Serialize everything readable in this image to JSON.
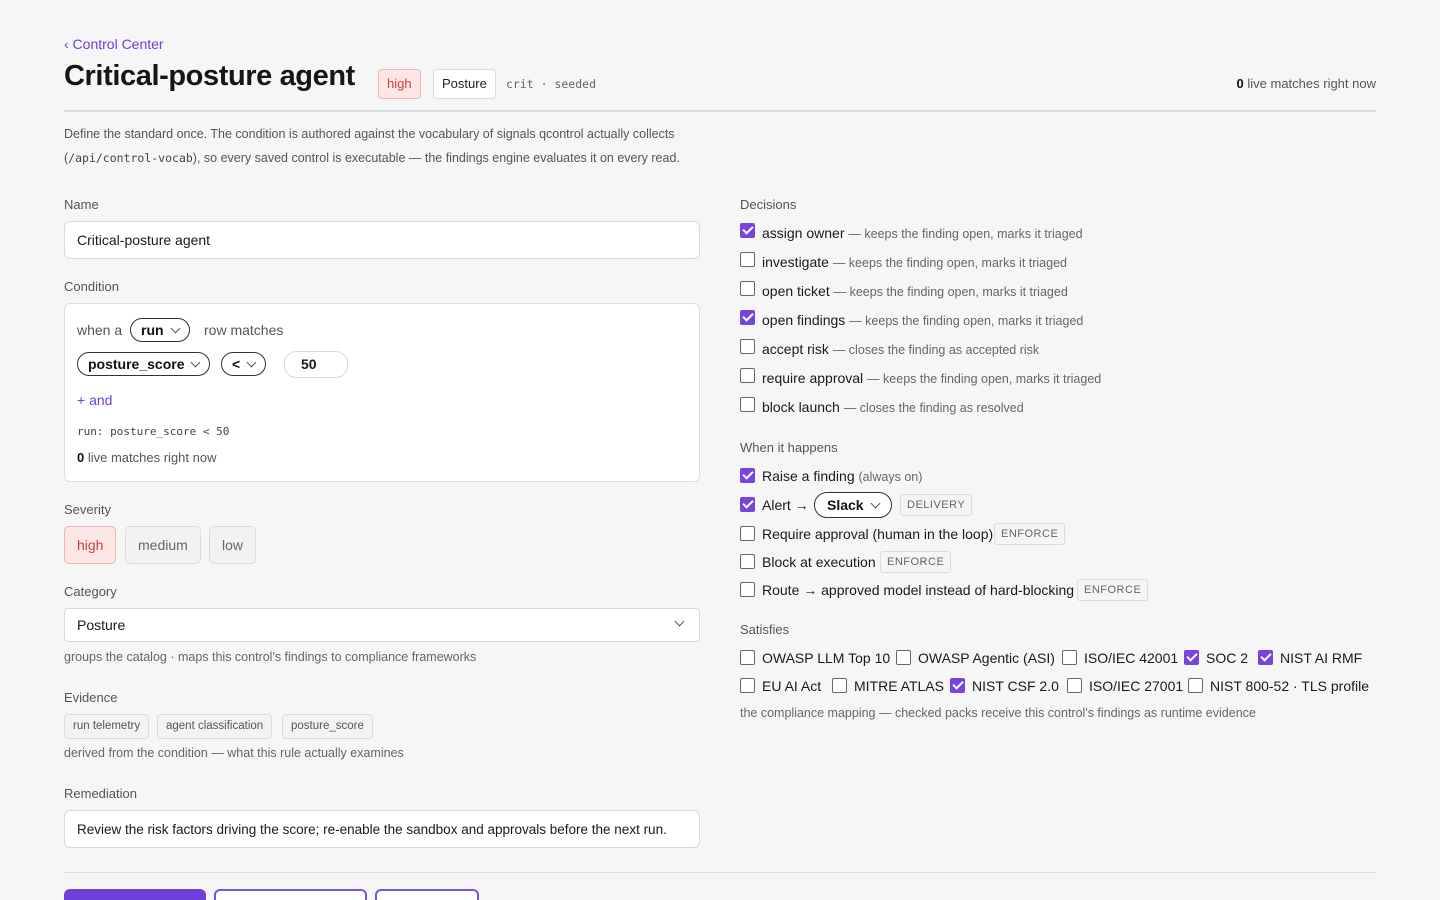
{
  "back_link": "‹ Control Center",
  "header": {
    "title": "Critical-posture agent",
    "severity_badge": "high",
    "category_badge": "Posture",
    "meta": "crit · seeded",
    "live_count": "0",
    "live_suffix": "live matches right now"
  },
  "intro": {
    "text_a": "Define the standard once. The condition is authored against the vocabulary of signals qcontrol actually collects (",
    "code": "/api/control-vocab",
    "text_b": "), so every saved control is executable — the findings engine evaluates it on every read."
  },
  "name": {
    "label": "Name",
    "value": "Critical-posture agent"
  },
  "condition": {
    "label": "Condition",
    "when_prefix": "when a",
    "entity": "run",
    "when_suffix": "row matches",
    "field": "posture_score",
    "operator": "<",
    "value": "50",
    "add_and": "+ and",
    "expression": "run: posture_score < 50",
    "live_count": "0",
    "live_suffix": "live matches right now"
  },
  "severity": {
    "label": "Severity",
    "options": [
      "high",
      "medium",
      "low"
    ],
    "selected": "high"
  },
  "category": {
    "label": "Category",
    "value": "Posture",
    "help": "groups the catalog · maps this control's findings to compliance frameworks"
  },
  "evidence": {
    "label": "Evidence",
    "tags": [
      "run telemetry",
      "agent classification",
      "posture_score"
    ],
    "help": "derived from the condition — what this rule actually examines"
  },
  "remediation": {
    "label": "Remediation",
    "value": "Review the risk factors driving the score; re-enable the sandbox and approvals before the next run."
  },
  "decisions": {
    "label": "Decisions",
    "items": [
      {
        "name": "assign owner",
        "desc": "— keeps the finding open, marks it triaged",
        "checked": true
      },
      {
        "name": "investigate",
        "desc": "— keeps the finding open, marks it triaged",
        "checked": false
      },
      {
        "name": "open ticket",
        "desc": "— keeps the finding open, marks it triaged",
        "checked": false
      },
      {
        "name": "open findings",
        "desc": "— keeps the finding open, marks it triaged",
        "checked": true
      },
      {
        "name": "accept risk",
        "desc": "— closes the finding as accepted risk",
        "checked": false
      },
      {
        "name": "require approval",
        "desc": "— keeps the finding open, marks it triaged",
        "checked": false
      },
      {
        "name": "block launch",
        "desc": "— closes the finding as resolved",
        "checked": false
      }
    ]
  },
  "when_it_happens": {
    "label": "When it happens",
    "raise": {
      "text": "Raise a finding",
      "note": "(always on)",
      "checked": true
    },
    "alert": {
      "text": "Alert →",
      "channel": "Slack",
      "tag": "DELIVERY",
      "checked": true
    },
    "require_approval": {
      "text": "Require approval (human in the loop)",
      "tag": "ENFORCE",
      "checked": false
    },
    "block": {
      "text": "Block at execution",
      "tag": "ENFORCE",
      "checked": false
    },
    "route": {
      "text": "Route → approved model instead of hard-blocking",
      "tag": "ENFORCE",
      "checked": false
    }
  },
  "satisfies": {
    "label": "Satisfies",
    "row1": [
      {
        "name": "OWASP LLM Top 10",
        "checked": false
      },
      {
        "name": "OWASP Agentic (ASI)",
        "checked": false
      },
      {
        "name": "ISO/IEC 42001",
        "checked": false
      },
      {
        "name": "SOC 2",
        "checked": true
      },
      {
        "name": "NIST AI RMF",
        "checked": true
      }
    ],
    "row2": [
      {
        "name": "EU AI Act",
        "checked": false
      },
      {
        "name": "MITRE ATLAS",
        "checked": false
      },
      {
        "name": "NIST CSF 2.0",
        "checked": true
      },
      {
        "name": "ISO/IEC 27001",
        "checked": false
      },
      {
        "name": "NIST 800-52 · TLS profile",
        "checked": false
      }
    ],
    "help": "the compliance mapping — checked packs receive this control's findings as runtime evidence"
  },
  "colors": {
    "accent": "#6d3fd8",
    "checkbox_on": "#7744dd",
    "severity_high": "#d23c3c",
    "severity_high_bg": "#fde6e6"
  }
}
